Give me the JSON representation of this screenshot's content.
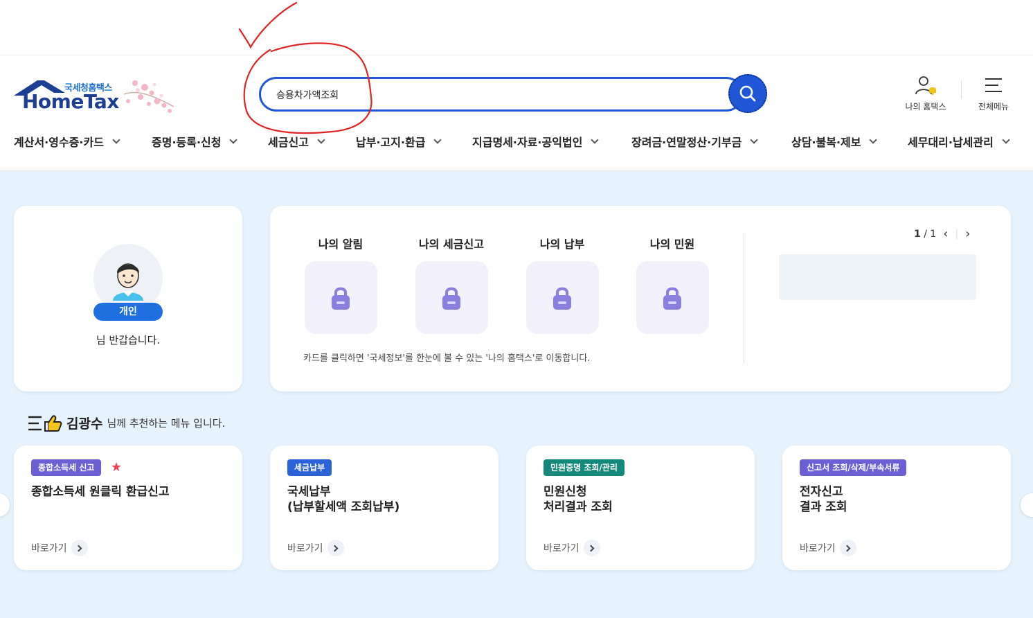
{
  "logo": {
    "sub": "국세청홈택스",
    "main": "HomeTax"
  },
  "search": {
    "value": "승용차가액조회"
  },
  "utility": {
    "my_hometax": "나의 홈택스",
    "all_menu": "전체메뉴"
  },
  "nav": [
    "계산서·영수증·카드",
    "증명·등록·신청",
    "세금신고",
    "납부·고지·환급",
    "지급명세·자료·공익법인",
    "장려금·연말정산·기부금",
    "상담·불복·제보",
    "세무대리·납세관리"
  ],
  "profile": {
    "badge": "개인",
    "greeting": "님 반갑습니다."
  },
  "my": {
    "items": [
      "나의 알림",
      "나의 세금신고",
      "나의 납부",
      "나의 민원"
    ],
    "note": "카드를 클릭하면 '국세정보'를 한눈에 볼 수 있는 '나의 홈택스'로 이동합니다.",
    "pager_current": "1",
    "pager_total": "/ 1"
  },
  "recommend": {
    "name": "김광수",
    "text": "님께 추천하는 메뉴 입니다.",
    "cards": [
      {
        "tag": "종합소득세 신고",
        "tag_color": "#6b5fd6",
        "title": "종합소득세 원클릭 환급신고",
        "go": "바로가기"
      },
      {
        "tag": "세금납부",
        "tag_color": "#2a62d8",
        "title": "국세납부\n(납부할세액 조회납부)",
        "go": "바로가기"
      },
      {
        "tag": "민원증명 조회/관리",
        "tag_color": "#12897a",
        "title": "민원신청\n처리결과 조회",
        "go": "바로가기"
      },
      {
        "tag": "신고서 조회/삭제/부속서류",
        "tag_color": "#6b5fd6",
        "title": "전자신고\n결과 조회",
        "go": "바로가기"
      }
    ]
  },
  "colors": {
    "accent": "#1f57d6",
    "background": "#e7f3fc",
    "annotation": "#e02424"
  }
}
